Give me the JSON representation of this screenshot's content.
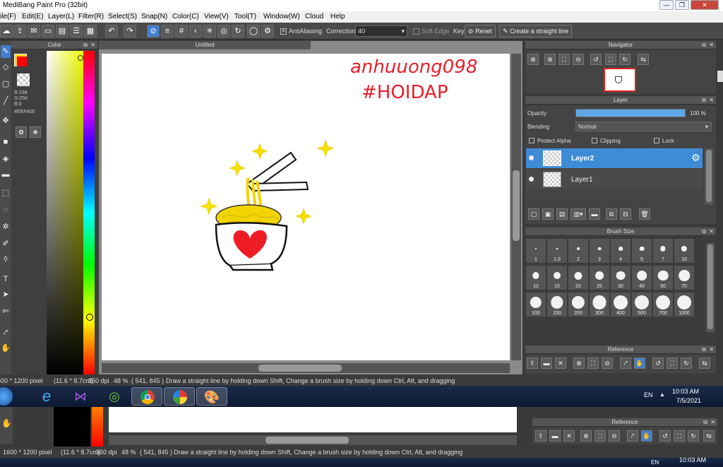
{
  "window": {
    "title": "MediBang Paint Pro (32bit)",
    "min": "—",
    "max": "❐",
    "close": "✕"
  },
  "menu": [
    "ile(F)",
    "Edit(E)",
    "Layer(L)",
    "Filter(R)",
    "Select(S)",
    "Snap(N)",
    "Color(C)",
    "View(V)",
    "Tool(T)",
    "Window(W)",
    "Cloud",
    "Help"
  ],
  "toolbar": {
    "antialiasing": "AntiAliasing",
    "correction_label": "Correction",
    "correction_value": "40",
    "soft_edge": "Soft Edge",
    "key": "Key",
    "reset": "Reset",
    "straight_line": "Create a straight line"
  },
  "color_panel": {
    "title": "Color",
    "r": "R:238",
    "g": "G:250",
    "b": "B:0",
    "hex": "#EEFA00",
    "primary": "#ff0000",
    "secondary": "#ffd200"
  },
  "canvas": {
    "tab": "Untitled",
    "signature_line1": "anhuuong098",
    "signature_line2": "#HOIDAP"
  },
  "navigator": {
    "title": "Navigator"
  },
  "layer_panel": {
    "title": "Layer",
    "opacity_label": "Opacity",
    "opacity_value": "100 %",
    "opacity_fraction": 1.0,
    "blending_label": "Blending",
    "blending_value": "Normal",
    "protect_alpha": "Protect Alpha",
    "clipping": "Clipping",
    "lock": "Lock",
    "layers": [
      {
        "name": "Layer2",
        "selected": true
      },
      {
        "name": "Layer1",
        "selected": false
      }
    ]
  },
  "brush_size": {
    "title": "Brush Size",
    "sizes": [
      "1",
      "1.5",
      "2",
      "3",
      "4",
      "5",
      "7",
      "10",
      "12",
      "15",
      "20",
      "25",
      "30",
      "40",
      "50",
      "70",
      "100",
      "150",
      "200",
      "300",
      "400",
      "500",
      "700",
      "1000"
    ]
  },
  "reference": {
    "title": "Reference"
  },
  "status": {
    "size": "600 * 1200 pixel",
    "cm": "(11.6 * 8.7cm)",
    "dpi": "350 dpi",
    "zoom": "48 %",
    "coords": "( 541, 845 )",
    "hint": "Draw a straight line by holding down Shift, Change a brush size by holding down Ctrl, Alt, and dragging"
  },
  "taskbar": {
    "lang": "EN",
    "time": "10:03 AM",
    "date": "7/5/2021"
  },
  "ghost": {
    "status_size": "1600 * 1200 pixel",
    "status_cm": "(11.6 * 8.7cm)",
    "status_dpi": "350 dpi",
    "status_zoom": "48 %",
    "status_coords": "( 541, 845 )",
    "status_hint": "Draw a straight line by holding down Shift, Change a brush size by holding down Ctrl, Alt, and dragging",
    "reference": "Reference",
    "lang": "EN",
    "time": "10:03 AM"
  }
}
